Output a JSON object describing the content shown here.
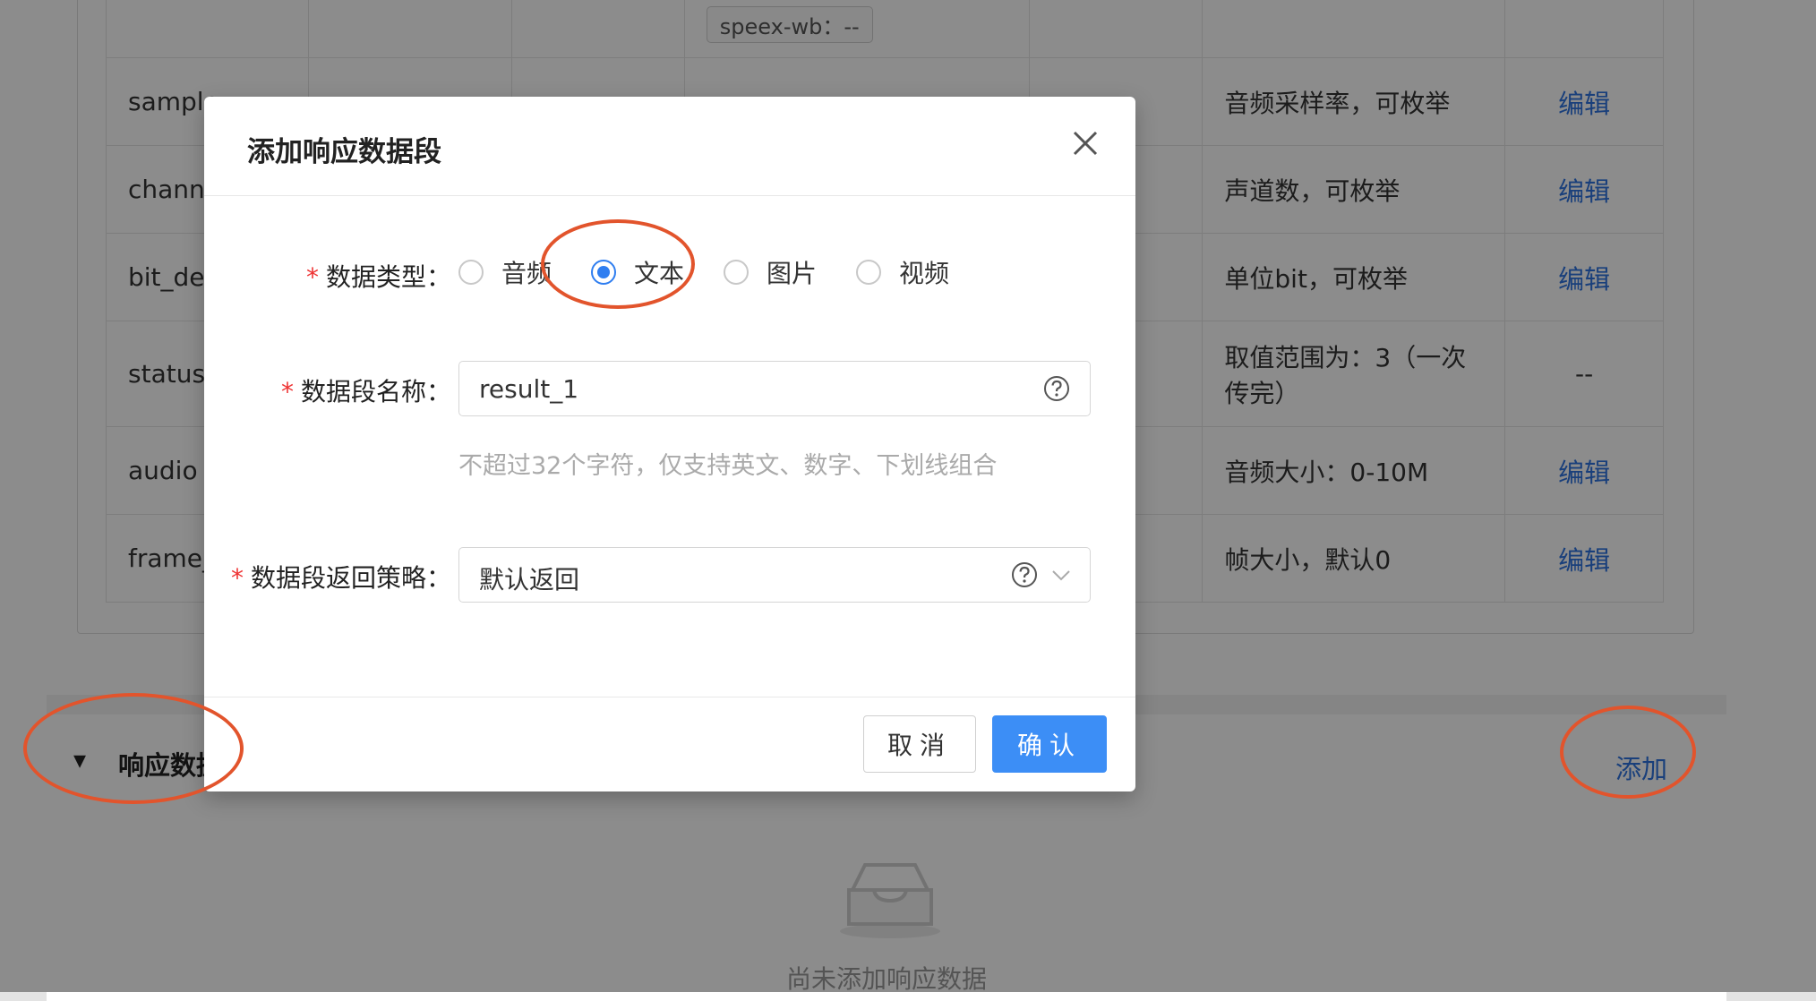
{
  "background": {
    "tags": [
      "speex-wb：--"
    ],
    "rows": [
      {
        "name": "sample",
        "desc": "音频采样率，可枚举",
        "action": "编辑"
      },
      {
        "name": "channe",
        "desc": "声道数，可枚举",
        "action": "编辑"
      },
      {
        "name": "bit_dep",
        "desc": "单位bit，可枚举",
        "action": "编辑"
      },
      {
        "name": "status",
        "desc": "取值范围为：3（一次传完）",
        "action": "--"
      },
      {
        "name": "audio",
        "desc": "音频大小：0-10M",
        "action": "编辑"
      },
      {
        "name": "frame_",
        "desc": "帧大小，默认0",
        "action": "编辑"
      }
    ],
    "section": {
      "toggle": "▾",
      "title": "响应数据",
      "add_label": "添加",
      "empty_text": "尚未添加响应数据"
    }
  },
  "modal": {
    "title": "添加响应数据段",
    "required_mark": "*",
    "data_type": {
      "label": "数据类型：",
      "options": [
        "音频",
        "文本",
        "图片",
        "视频"
      ],
      "selected": "文本"
    },
    "segment_name": {
      "label": "数据段名称：",
      "value": "result_1",
      "hint": "不超过32个字符，仅支持英文、数字、下划线组合"
    },
    "return_strategy": {
      "label": "数据段返回策略：",
      "value": "默认返回"
    },
    "buttons": {
      "cancel": "取消",
      "confirm": "确认"
    }
  },
  "colors": {
    "primary": "#3c8ef6",
    "link": "#2f74e0",
    "required": "#ee3333",
    "annotation": "#e2542c"
  },
  "icons": [
    "close-icon",
    "help-icon",
    "chevron-down-icon",
    "caret-down-icon",
    "empty-inbox-icon"
  ]
}
